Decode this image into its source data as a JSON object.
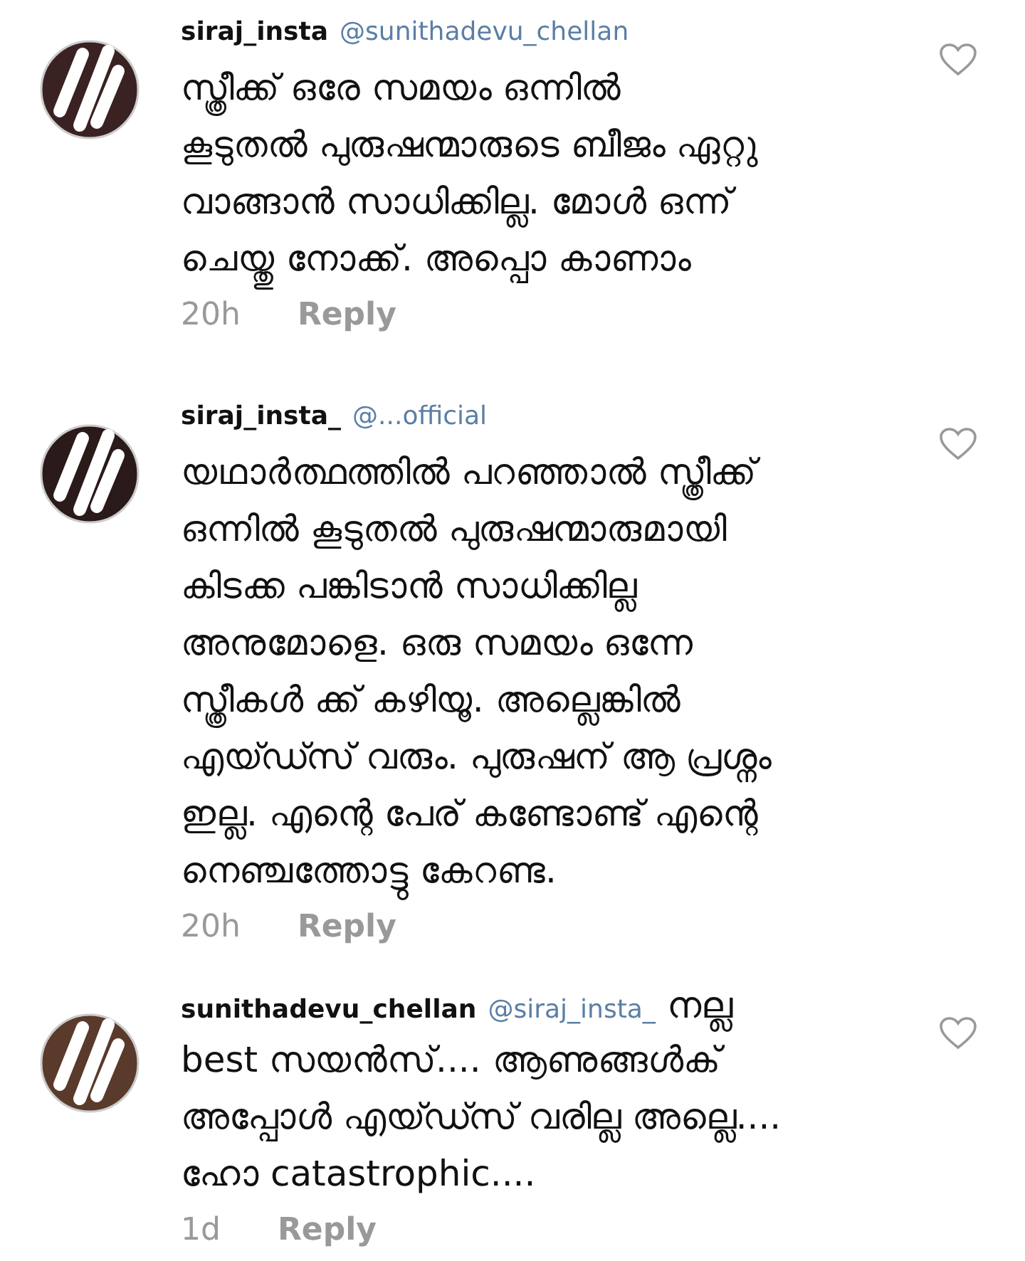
{
  "comments": [
    {
      "username": "siraj_insta",
      "mention": "@sunithadevu_chellan",
      "lines": [
        "സ്ത്രീക്ക് ഒരേ സമയം ഒന്നിൽ",
        "കൂടുതൽ പുരുഷന്മാരുടെ ബീജം ഏറ്റു",
        "വാങ്ങാൻ സാധിക്കില്ല. മോൾ ഒന്ന്",
        "ചെയ്തു നോക്ക്. അപ്പൊ കാണാം"
      ],
      "time": "20h",
      "reply": "Reply",
      "liked": false
    },
    {
      "username": "siraj_insta_",
      "mention": "@...official",
      "lines": [
        "യഥാർത്ഥത്തിൽ പറഞ്ഞാൽ സ്ത്രീക്ക്",
        "ഒന്നിൽ കൂടുതൽ പുരുഷന്മാരുമായി",
        "കിടക്ക പങ്കിടാൻ സാധിക്കില്ല",
        "അനുമോളെ. ഒരു സമയം ഒന്നേ",
        "സ്ത്രീകൾ ക്ക് കഴിയൂ. അല്ലെങ്കിൽ",
        "എയ്ഡ്സ് വരും. പുരുഷന് ആ പ്രശ്നം",
        "ഇല്ല. എന്റെ പേര് കണ്ടോണ്ട് എന്റെ",
        "നെഞ്ചത്തോട്ടു കേറണ്ട."
      ],
      "time": "20h",
      "reply": "Reply",
      "liked": false
    },
    {
      "username": "sunithadevu_chellan",
      "mention": "@siraj_insta_",
      "lines": [
        "നല്ല",
        "best സയൻസ്.... ആണുങ്ങൾക്",
        "അപ്പോൾ എയ്ഡ്സ് വരില്ല അല്ലെ....",
        "ഹോ catastrophic...."
      ],
      "time": "1d",
      "reply": "Reply",
      "liked": false
    }
  ]
}
